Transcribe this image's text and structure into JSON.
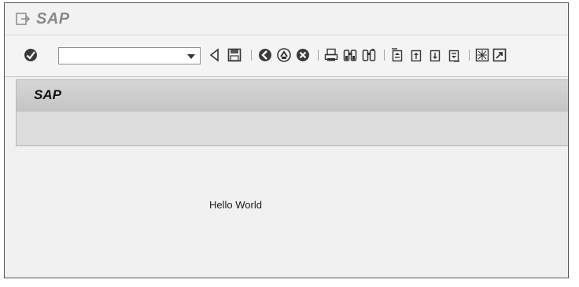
{
  "window": {
    "title": "SAP",
    "menu_icon": "exit-menu-icon"
  },
  "toolbar": {
    "enter_icon": "enter-check-icon",
    "command_field": {
      "value": "",
      "placeholder": ""
    },
    "dropdown_icon": "chevron-down-icon",
    "buttons": [
      "back-triangle-icon",
      "save-icon",
      "back-icon",
      "exit-icon",
      "cancel-icon",
      "print-icon",
      "find-icon",
      "find-next-icon",
      "first-page-icon",
      "previous-page-icon",
      "next-page-icon",
      "last-page-icon",
      "create-session-icon",
      "shortcut-icon"
    ]
  },
  "page": {
    "title": "SAP",
    "content_text": "Hello World"
  },
  "colors": {
    "title_gray": "#8a8a8a",
    "icon_dark": "#333333",
    "header_bg": "#cfcfcf",
    "content_bg": "#f0f0f0"
  }
}
